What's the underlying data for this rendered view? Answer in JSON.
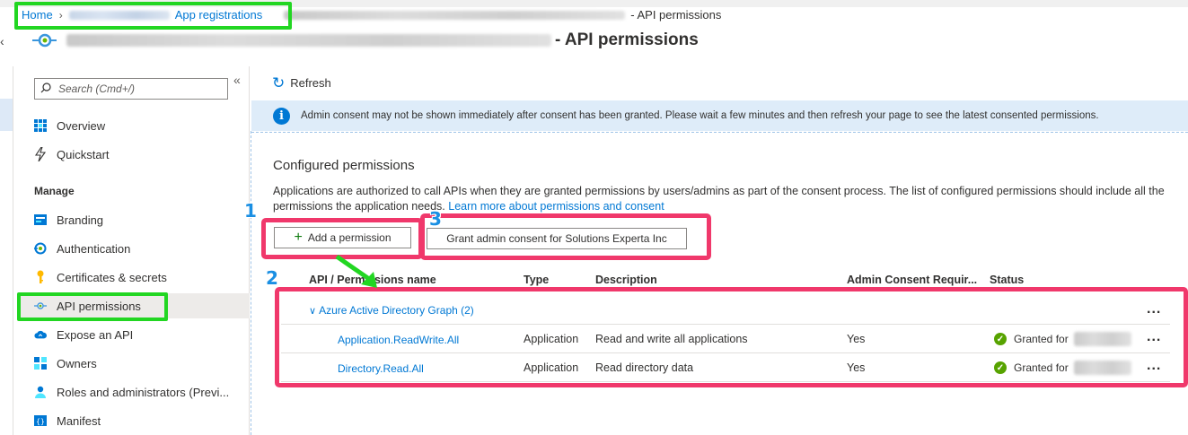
{
  "breadcrumb": {
    "home": "Home",
    "app_registrations": "App registrations",
    "current": "- API permissions"
  },
  "blade": {
    "title_suffix": "- API permissions"
  },
  "nav": {
    "search_placeholder": "Search (Cmd+/)",
    "items": [
      {
        "label": "Overview",
        "icon": "grid-icon"
      },
      {
        "label": "Quickstart",
        "icon": "lightning-icon"
      },
      {
        "label": "Branding",
        "icon": "branding-icon"
      },
      {
        "label": "Authentication",
        "icon": "authentication-icon"
      },
      {
        "label": "Certificates & secrets",
        "icon": "key-icon"
      },
      {
        "label": "API permissions",
        "icon": "api-permissions-icon"
      },
      {
        "label": "Expose an API",
        "icon": "cloud-icon"
      },
      {
        "label": "Owners",
        "icon": "owners-icon"
      },
      {
        "label": "Roles and administrators (Previ...",
        "icon": "person-icon"
      },
      {
        "label": "Manifest",
        "icon": "manifest-icon"
      }
    ],
    "section_manage": "Manage",
    "active_item": "API permissions"
  },
  "toolbar": {
    "refresh_label": "Refresh"
  },
  "info_bar": {
    "message": "Admin consent may not be shown immediately after consent has been granted. Please wait a few minutes and then refresh your page to see the latest consented permissions."
  },
  "configured": {
    "title": "Configured permissions",
    "description": "Applications are authorized to call APIs when they are granted permissions by users/admins as part of the consent process. The list of configured permissions should include all the permissions the application needs.",
    "learn_more": "Learn more about permissions and consent",
    "add_button": "Add a permission",
    "grant_button": "Grant admin consent for Solutions Experta Inc"
  },
  "table": {
    "headers": [
      "API / Permissions name",
      "Type",
      "Description",
      "Admin Consent Requir...",
      "Status"
    ],
    "group": "Azure Active Directory Graph (2)",
    "rows": [
      {
        "name": "Application.ReadWrite.All",
        "type": "Application",
        "description": "Read and write all applications",
        "admin_consent": "Yes",
        "status": "Granted for"
      },
      {
        "name": "Directory.Read.All",
        "type": "Application",
        "description": "Read directory data",
        "admin_consent": "Yes",
        "status": "Granted for"
      }
    ],
    "more_label": "..."
  },
  "annotations": {
    "step1": "1",
    "step2": "2",
    "step3": "3"
  },
  "colors": {
    "accent": "#0078d4",
    "highlight_green": "#22d622",
    "highlight_pink": "#f0386b",
    "info_bg": "#deecf9",
    "success": "#57a300"
  }
}
